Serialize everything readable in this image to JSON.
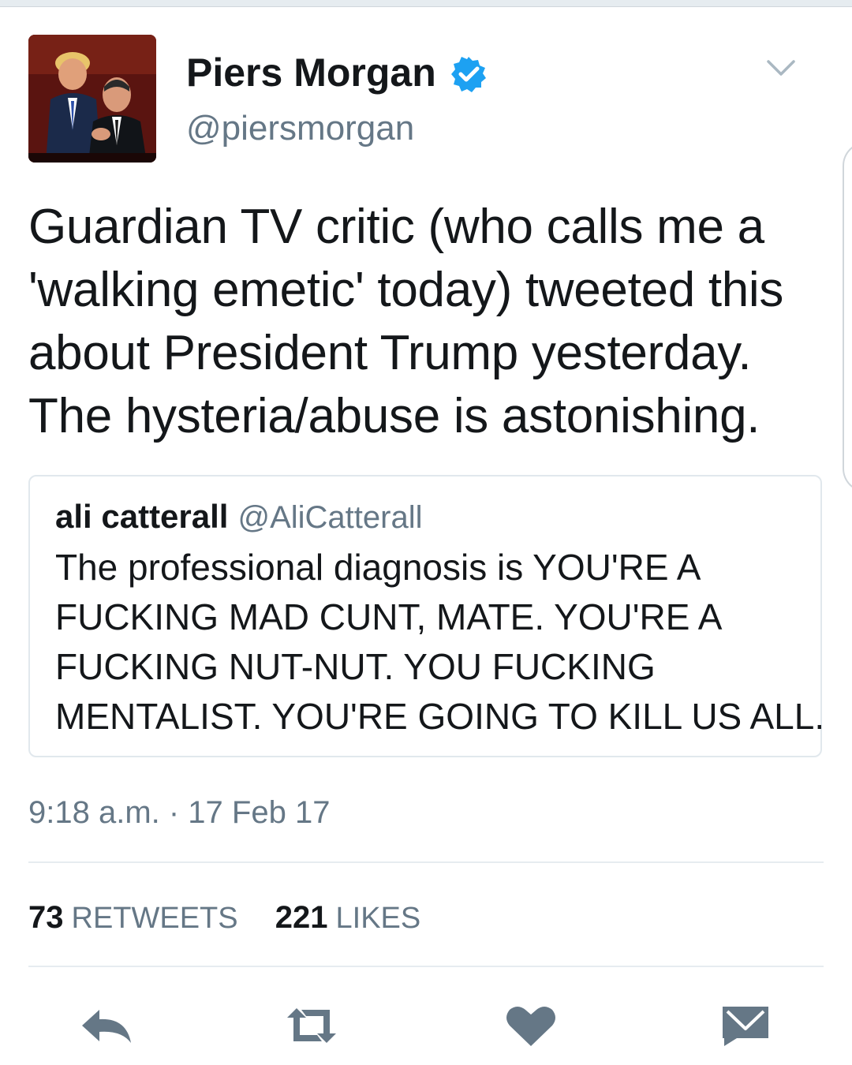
{
  "tweet": {
    "author": {
      "display_name": "Piers Morgan",
      "handle": "@piersmorgan",
      "verified": true
    },
    "text_lines": [
      "Guardian TV critic (who calls me a",
      "'walking emetic' today) tweeted this",
      "about President Trump yesterday.",
      "The hysteria/abuse is astonishing."
    ],
    "quoted_tweet": {
      "author_name": "ali catterall",
      "author_handle": "@AliCatterall",
      "text_lines": [
        "The professional diagnosis is YOU'RE A",
        "FUCKING MAD CUNT, MATE. YOU'RE A",
        "FUCKING NUT-NUT. YOU FUCKING",
        "MENTALIST. YOU'RE GOING TO KILL US ALL."
      ]
    },
    "timestamp": "9:18 a.m. · 17 Feb 17",
    "stats": {
      "retweets_count": "73",
      "retweets_label": "RETWEETS",
      "likes_count": "221",
      "likes_label": "LIKES"
    }
  },
  "actions": {
    "icons": [
      "reply-icon",
      "retweet-icon",
      "like-icon",
      "direct-message-icon"
    ]
  },
  "colors": {
    "text_primary": "#14171a",
    "text_secondary": "#657786",
    "verified_blue": "#1da1f2",
    "icon_gray": "#657786",
    "border": "#e1e8ed"
  }
}
